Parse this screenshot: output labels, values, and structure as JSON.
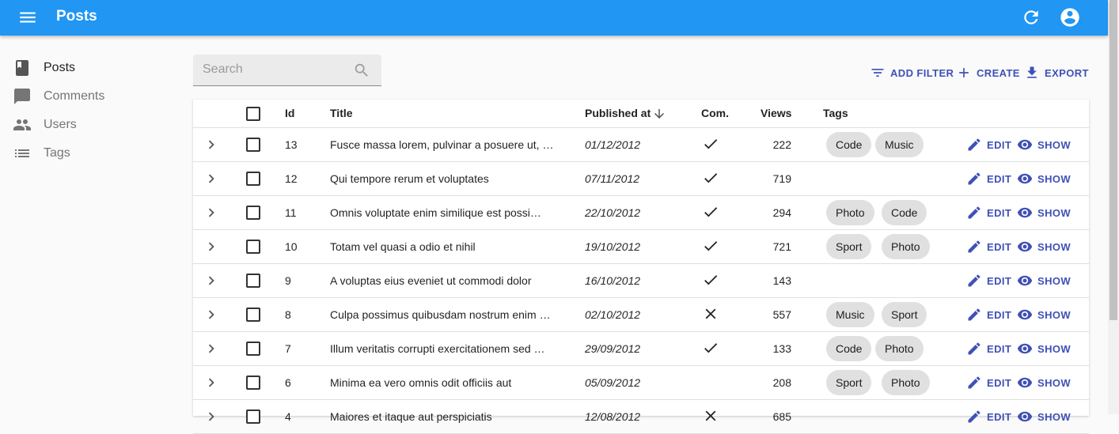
{
  "appbar": {
    "title": "Posts"
  },
  "sidebar": {
    "items": [
      {
        "label": "Posts",
        "icon": "book-icon",
        "active": true
      },
      {
        "label": "Comments",
        "icon": "chat-icon",
        "active": false
      },
      {
        "label": "Users",
        "icon": "people-icon",
        "active": false
      },
      {
        "label": "Tags",
        "icon": "list-icon",
        "active": false
      }
    ]
  },
  "search": {
    "placeholder": "Search",
    "value": ""
  },
  "toolbar": {
    "add_filter": "ADD FILTER",
    "create": "CREATE",
    "export": "EXPORT"
  },
  "table": {
    "headers": {
      "id": "Id",
      "title": "Title",
      "published_at": "Published at",
      "commentable": "Com.",
      "views": "Views",
      "tags": "Tags"
    },
    "sort": {
      "column": "published_at",
      "direction": "desc"
    },
    "edit_label": "EDIT",
    "show_label": "SHOW",
    "rows": [
      {
        "id": "13",
        "title": "Fusce massa lorem, pulvinar a posuere ut, …",
        "published_at": "01/12/2012",
        "commentable": "check",
        "views": "222",
        "tags": [
          "Code",
          "Music"
        ]
      },
      {
        "id": "12",
        "title": "Qui tempore rerum et voluptates",
        "published_at": "07/11/2012",
        "commentable": "check",
        "views": "719",
        "tags": []
      },
      {
        "id": "11",
        "title": "Omnis voluptate enim similique est possi…",
        "published_at": "22/10/2012",
        "commentable": "check",
        "views": "294",
        "tags": [
          "Photo",
          "Code"
        ]
      },
      {
        "id": "10",
        "title": "Totam vel quasi a odio et nihil",
        "published_at": "19/10/2012",
        "commentable": "check",
        "views": "721",
        "tags": [
          "Sport",
          "Photo"
        ]
      },
      {
        "id": "9",
        "title": "A voluptas eius eveniet ut commodi dolor",
        "published_at": "16/10/2012",
        "commentable": "check",
        "views": "143",
        "tags": []
      },
      {
        "id": "8",
        "title": "Culpa possimus quibusdam nostrum enim …",
        "published_at": "02/10/2012",
        "commentable": "cross",
        "views": "557",
        "tags": [
          "Music",
          "Sport"
        ]
      },
      {
        "id": "7",
        "title": "Illum veritatis corrupti exercitationem sed …",
        "published_at": "29/09/2012",
        "commentable": "check",
        "views": "133",
        "tags": [
          "Code",
          "Photo"
        ]
      },
      {
        "id": "6",
        "title": "Minima ea vero omnis odit officiis aut",
        "published_at": "05/09/2012",
        "commentable": "none",
        "views": "208",
        "tags": [
          "Sport",
          "Photo"
        ]
      },
      {
        "id": "4",
        "title": "Maiores et itaque aut perspiciatis",
        "published_at": "12/08/2012",
        "commentable": "cross",
        "views": "685",
        "tags": []
      }
    ]
  }
}
